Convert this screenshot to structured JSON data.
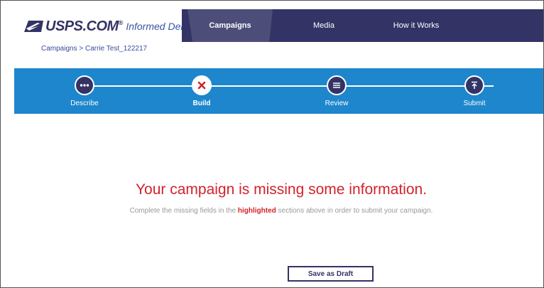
{
  "header": {
    "logo_usps": "USPS.COM",
    "logo_registered": "®",
    "logo_informed": "Informed Delivery",
    "logo_mark": "○"
  },
  "nav": {
    "tabs": [
      {
        "label": "Campaigns",
        "active": true
      },
      {
        "label": "Media",
        "active": false
      },
      {
        "label": "How it Works",
        "active": false
      }
    ]
  },
  "breadcrumb": "Campaigns > Carrie Test_122217",
  "progress": {
    "steps": [
      {
        "label": "Describe",
        "icon": "ellipsis-icon",
        "state": "complete"
      },
      {
        "label": "Build",
        "icon": "close-icon",
        "state": "error"
      },
      {
        "label": "Review",
        "icon": "lines-icon",
        "state": "pending"
      },
      {
        "label": "Submit",
        "icon": "upload-icon",
        "state": "pending"
      }
    ]
  },
  "message": {
    "headline": "Your campaign is missing some information.",
    "sub_before": "Complete the missing fields in the ",
    "sub_highlight": "highlighted",
    "sub_after": " sections above in order to submit your campaign."
  },
  "actions": {
    "save_draft": "Save as Draft"
  },
  "colors": {
    "navy": "#333366",
    "blue_bar": "#1e86cc",
    "error_red": "#d2232a",
    "muted_text": "#999999"
  }
}
